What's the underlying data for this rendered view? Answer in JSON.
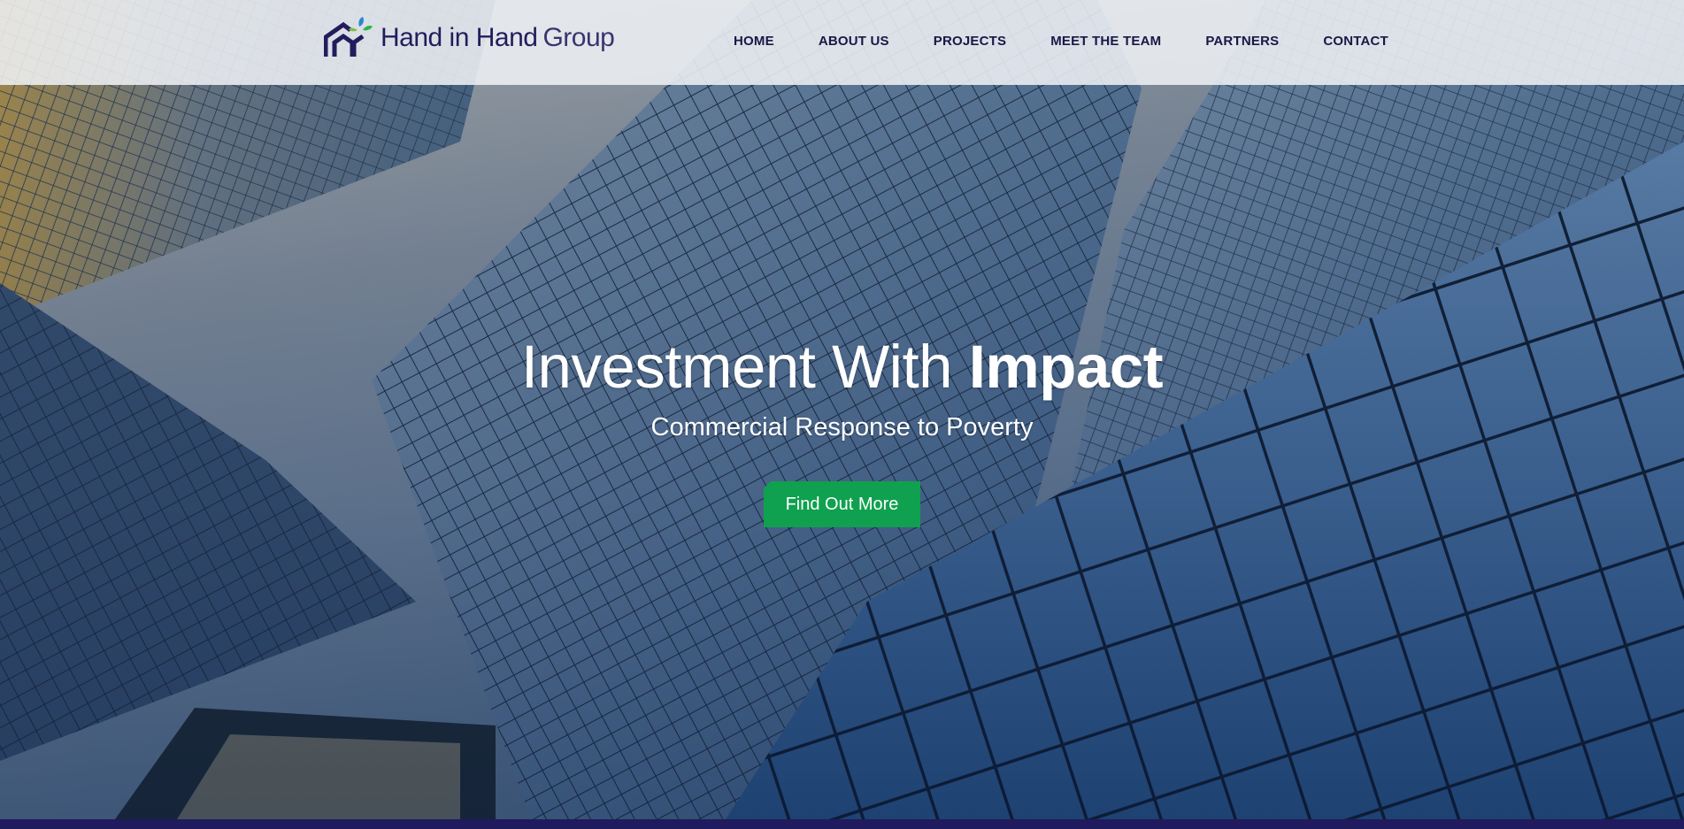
{
  "brand": {
    "name_main": "Hand in Hand",
    "name_suffix": "Group",
    "logo_icon": "house-leaf-logo-icon",
    "colors": {
      "navy": "#241c5c",
      "leaf_green": "#2db34a",
      "leaf_blue": "#2f86d0",
      "cta_green": "#0fa14f"
    }
  },
  "nav": {
    "items": [
      {
        "label": "HOME"
      },
      {
        "label": "ABOUT US"
      },
      {
        "label": "PROJECTS"
      },
      {
        "label": "MEET THE TEAM"
      },
      {
        "label": "PARTNERS"
      },
      {
        "label": "CONTACT"
      }
    ]
  },
  "hero": {
    "title_regular": "Investment With ",
    "title_bold": "Impact",
    "subtitle": "Commercial Response to Poverty",
    "cta_label": "Find Out More",
    "background": "glass-skyscrapers-photo"
  }
}
